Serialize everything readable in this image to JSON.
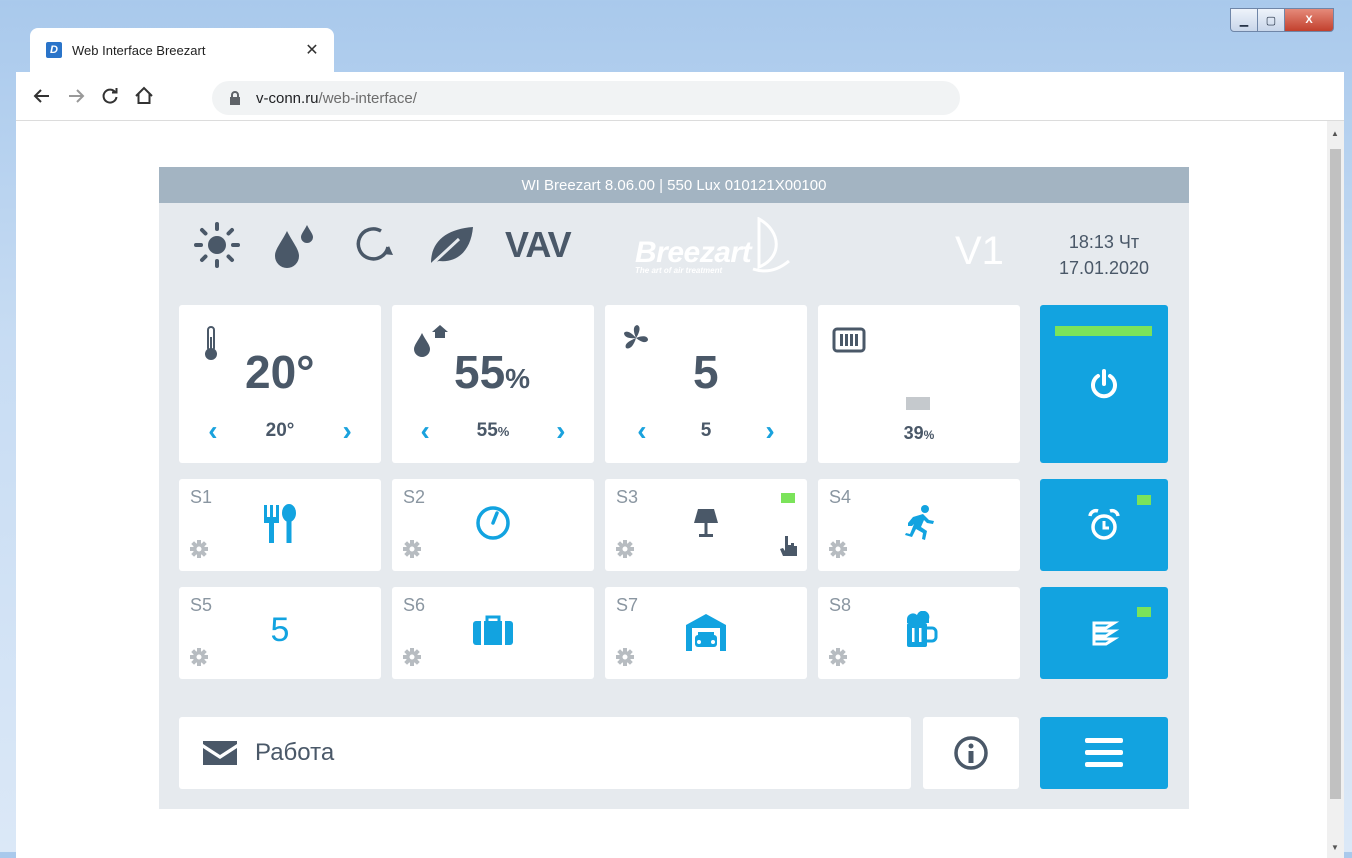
{
  "browser": {
    "tab_title": "Web Interface Breezart",
    "tab_close": "✕",
    "url_host": "v-conn.ru",
    "url_path": "/web-interface/",
    "window_controls": {
      "minimize": "▁",
      "maximize": "▢",
      "close": "X"
    }
  },
  "panel": {
    "header": "WI Breezart 8.06.00 | 550 Lux 010121X00100",
    "vav_label": "VAV",
    "brand_name": "Breezart",
    "brand_tagline": "The art of air treatment",
    "mode_label": "V1",
    "time": "18:13 Чт",
    "date": "17.01.2020"
  },
  "tiles": {
    "temperature": {
      "current": "20°",
      "setpoint": "20°",
      "prev": "‹",
      "next": "›"
    },
    "humidity": {
      "current": "55",
      "unit": "%",
      "setpoint": "55",
      "setpoint_unit": "%",
      "prev": "‹",
      "next": "›"
    },
    "fan": {
      "current": "5",
      "setpoint": "5",
      "prev": "‹",
      "next": "›"
    },
    "heater": {
      "value": "39",
      "unit": "%"
    }
  },
  "scenarios": [
    {
      "label": "S1",
      "icon": "utensils-icon"
    },
    {
      "label": "S2",
      "icon": "clock-icon"
    },
    {
      "label": "S3",
      "icon": "lamp-icon",
      "active": true
    },
    {
      "label": "S4",
      "icon": "running-person-icon"
    },
    {
      "label": "S5",
      "value": "5"
    },
    {
      "label": "S6",
      "icon": "briefcase-icon"
    },
    {
      "label": "S7",
      "icon": "garage-icon"
    },
    {
      "label": "S8",
      "icon": "beer-mug-icon"
    }
  ],
  "status_message": "Работа",
  "colors": {
    "accent": "#12a3e0",
    "indicator": "#7be35a",
    "text": "#4a5868",
    "header_bar": "#a3b4c2"
  }
}
